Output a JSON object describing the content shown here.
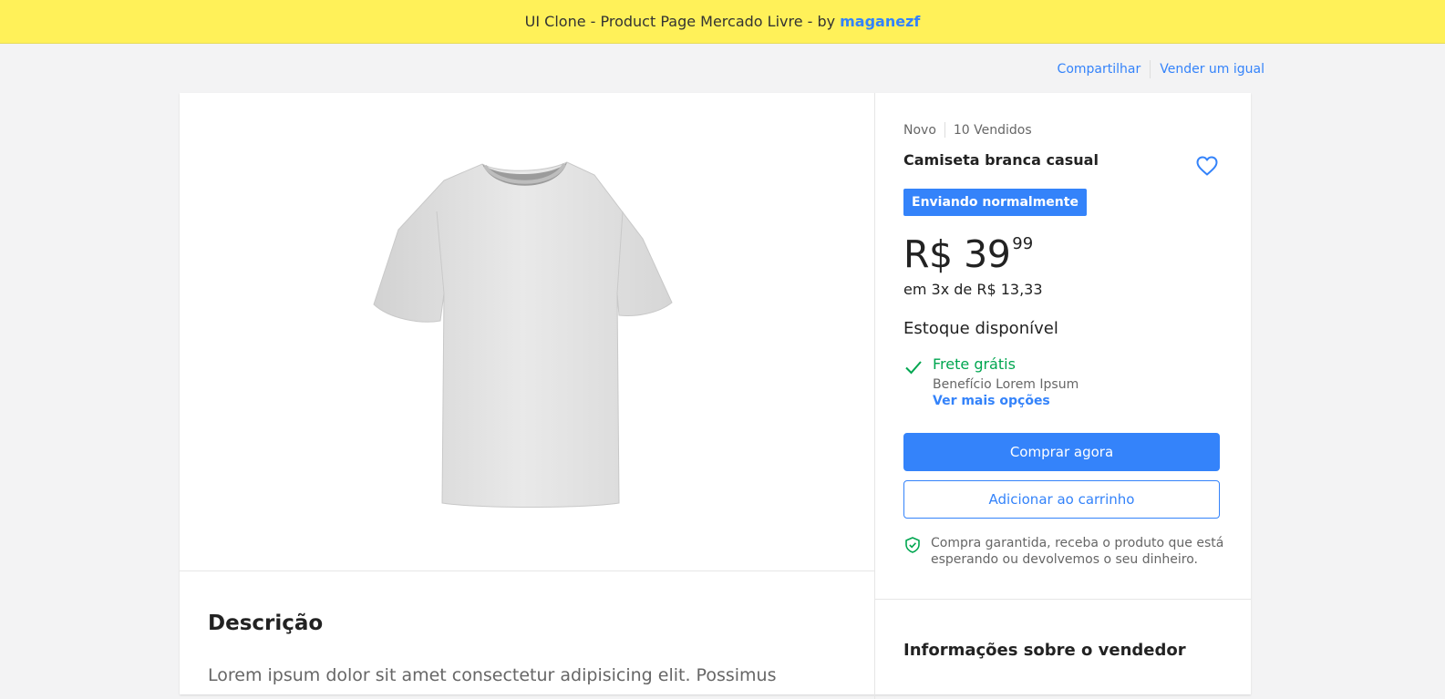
{
  "banner": {
    "text": "UI Clone - Product Page Mercado Livre - by",
    "author": "maganezf",
    "color": "#fff159"
  },
  "top_actions": {
    "share": "Compartilhar",
    "sell": "Vender um igual"
  },
  "product": {
    "image_alt": "white-tshirt",
    "condition": "Novo",
    "sold": "10 Vendidos",
    "title": "Camiseta branca casual",
    "shipping_badge": "Enviando normalmente",
    "price_main": "R$ 39",
    "price_cents": "99",
    "installments": "em 3x de R$ 13,33",
    "stock": "Estoque disponível",
    "shipping": {
      "title": "Frete grátis",
      "subtitle": "Benefício Lorem Ipsum",
      "more": "Ver mais opções"
    },
    "buy_now": "Comprar agora",
    "add_to_cart": "Adicionar ao carrinho",
    "guarantee": "Compra garantida, receba o produto que está esperando ou devolvemos o seu dinheiro."
  },
  "description": {
    "heading": "Descrição",
    "text": "Lorem ipsum dolor sit amet consectetur adipisicing elit. Possimus"
  },
  "seller": {
    "heading": "Informações sobre o vendedor"
  },
  "colors": {
    "accent": "#3483fa",
    "success": "#00a650",
    "banner": "#fff159"
  },
  "icons": {
    "favorite": "heart-outline-icon",
    "shipping": "check-icon",
    "guarantee": "shield-check-icon"
  }
}
